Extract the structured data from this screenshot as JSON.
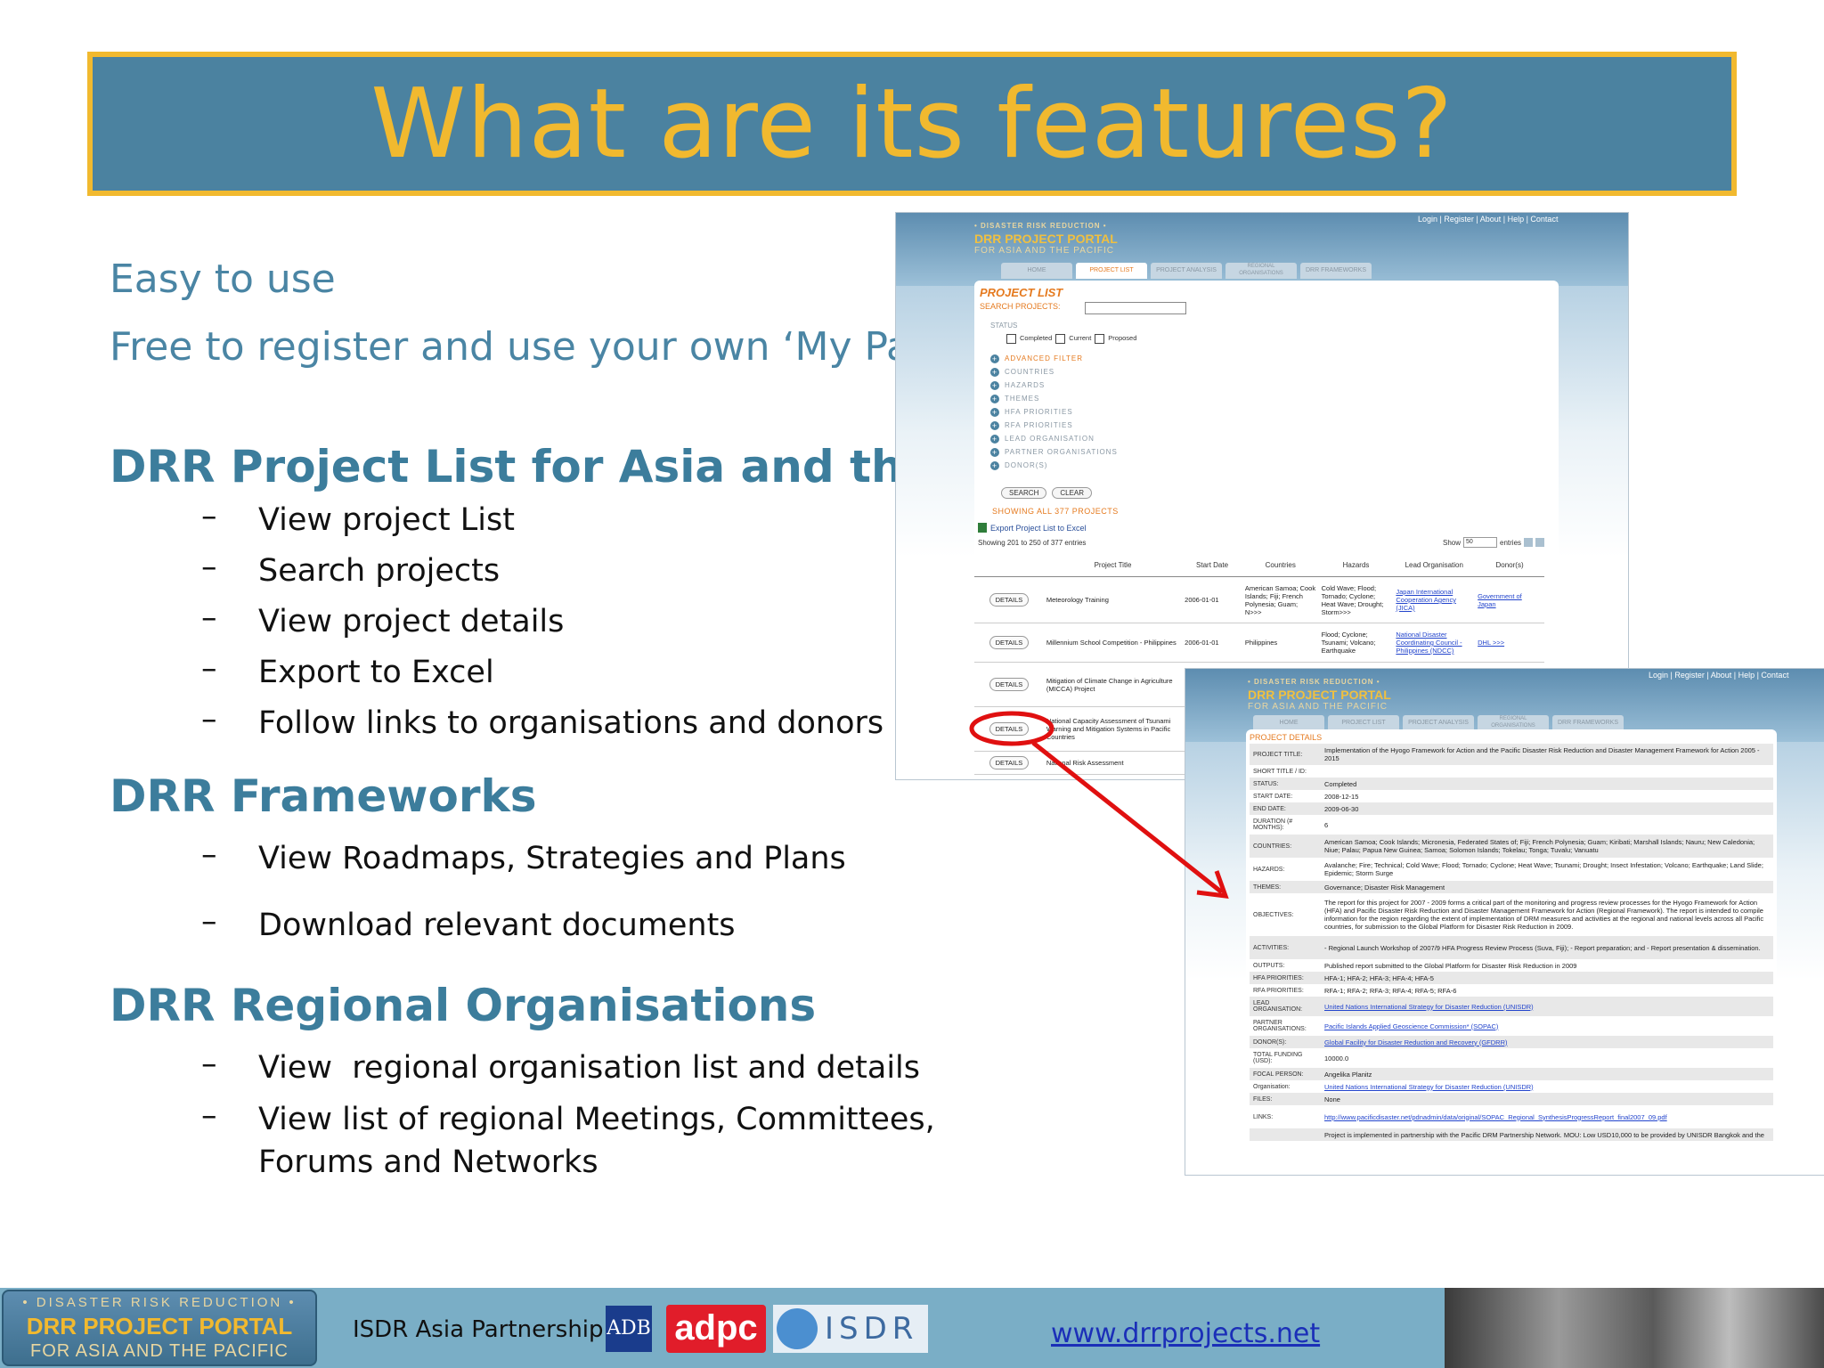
{
  "title": "What are its features?",
  "intro": [
    "Easy to use",
    "Free to register and use your own ‘My Page’"
  ],
  "sections": [
    {
      "heading": "DRR Project List for Asia and the Pacific",
      "bullets": [
        "View project List",
        "Search projects",
        "View project details",
        "Export to Excel",
        "Follow links to organisations and donors"
      ]
    },
    {
      "heading": "DRR Frameworks",
      "bullets": [
        "View Roadmaps, Strategies and Plans",
        "Download relevant documents"
      ]
    },
    {
      "heading": "DRR Regional Organisations",
      "bullets": [
        "View  regional organisation list and details",
        "View list of regional Meetings, Committees,\nForums and Networks"
      ]
    }
  ],
  "bullet_dash": "–",
  "portal": {
    "line1": "• DISASTER RISK REDUCTION •",
    "line2": "DRR PROJECT PORTAL",
    "line3": "FOR ASIA AND THE PACIFIC",
    "toplinks": "Login | Register | About | Help | Contact",
    "tabs": [
      "HOME",
      "PROJECT LIST",
      "PROJECT ANALYSIS",
      "REGIONAL ORGANISATIONS",
      "DRR FRAMEWORKS"
    ]
  },
  "project_list": {
    "heading": "PROJECT LIST",
    "search_label": "SEARCH PROJECTS:",
    "status_label": "STATUS",
    "status_options": [
      "Completed",
      "Current",
      "Proposed"
    ],
    "filters": [
      "ADVANCED FILTER",
      "COUNTRIES",
      "HAZARDS",
      "THEMES",
      "HFA PRIORITIES",
      "RFA PRIORITIES",
      "LEAD ORGANISATION",
      "PARTNER ORGANISATIONS",
      "DONOR(S)"
    ],
    "search_btn": "SEARCH",
    "clear_btn": "CLEAR",
    "showing": "SHOWING ALL 377 PROJECTS",
    "export": "Export Project List to Excel",
    "showing_range": "Showing 201 to 250 of 377 entries",
    "show_label": "Show",
    "show_value": "50",
    "entries_label": "entries",
    "columns": [
      "",
      "Project Title",
      "Start Date",
      "Countries",
      "Hazards",
      "Lead Organisation",
      "Donor(s)"
    ],
    "details_btn": "DETAILS",
    "rows": [
      {
        "title": "Meteorology Training",
        "date": "2006-01-01",
        "countries": "American Samoa; Cook Islands; Fiji; French Polynesia; Guam; N>>>",
        "hazards": "Cold Wave; Flood; Tornado; Cyclone; Heat Wave; Drought; Storm>>>",
        "lead": "Japan International Cooperation Agency (JICA)",
        "donor": "Government of Japan"
      },
      {
        "title": "Millennium School Competition - Philippines",
        "date": "2006-01-01",
        "countries": "Philippines",
        "hazards": "Flood; Cyclone; Tsunami; Volcano; Earthquake",
        "lead": "National Disaster Coordinating Council - Philippines (NDCC)",
        "donor": "DHL >>>"
      },
      {
        "title": "Mitigation of Climate Change in Agriculture (MICCA) Project",
        "date": "",
        "countries": "",
        "hazards": "",
        "lead": "",
        "donor": ""
      },
      {
        "title": "National Capacity Assessment of Tsunami Warning and Mitigation Systems in Pacific Countries",
        "date": "",
        "countries": "",
        "hazards": "",
        "lead": "",
        "donor": ""
      },
      {
        "title": "National Risk Assessment",
        "date": "",
        "countries": "",
        "hazards": "",
        "lead": "",
        "donor": ""
      }
    ]
  },
  "project_details": {
    "heading": "PROJECT DETAILS",
    "fields": [
      {
        "label": "PROJECT TITLE:",
        "value": "Implementation of the Hyogo Framework for Action and the Pacific Disaster Risk Reduction and Disaster Management Framework for Action 2005 - 2015"
      },
      {
        "label": "SHORT TITLE / ID:",
        "value": ""
      },
      {
        "label": "STATUS:",
        "value": "Completed"
      },
      {
        "label": "START DATE:",
        "value": "2008-12-15"
      },
      {
        "label": "END DATE:",
        "value": "2009-06-30"
      },
      {
        "label": "DURATION (# MONTHS):",
        "value": "6"
      },
      {
        "label": "COUNTRIES:",
        "value": "American Samoa; Cook Islands; Micronesia, Federated States of; Fiji; French Polynesia; Guam; Kiribati; Marshall Islands; Nauru; New Caledonia; Niue; Palau; Papua New Guinea; Samoa; Solomon Islands; Tokelau; Tonga; Tuvalu; Vanuatu"
      },
      {
        "label": "HAZARDS:",
        "value": "Avalanche; Fire; Technical; Cold Wave; Flood; Tornado; Cyclone; Heat Wave; Tsunami; Drought; Insect Infestation; Volcano; Earthquake; Land Slide; Epidemic; Storm Surge"
      },
      {
        "label": "THEMES:",
        "value": "Governance; Disaster Risk Management"
      },
      {
        "label": "OBJECTIVES:",
        "value": "The report for this project for 2007 - 2009 forms a critical part of the monitoring and progress review processes for the Hyogo Framework for Action (HFA) and Pacific Disaster Risk Reduction and Disaster Management Framework for Action (Regional Framework). The report is intended to compile information for the region regarding the extent of implementation of DRM measures and activities at the regional and national levels across all Pacific countries, for submission to the Global Platform for Disaster Risk Reduction in 2009."
      },
      {
        "label": "ACTIVITIES:",
        "value": "- Regional Launch Workshop of 2007/9 HFA Progress Review Process (Suva, Fiji); - Report preparation; and - Report presentation & dissemination."
      },
      {
        "label": "OUTPUTS:",
        "value": "Published report submitted to the Global Platform for Disaster Risk Reduction in 2009"
      },
      {
        "label": "HFA PRIORITIES:",
        "value": "HFA-1; HFA-2; HFA-3; HFA-4; HFA-5"
      },
      {
        "label": "RFA PRIORITIES:",
        "value": "RFA-1; RFA-2; RFA-3; RFA-4; RFA-5; RFA-6"
      },
      {
        "label": "LEAD ORGANISATION:",
        "value": "United Nations International Strategy for Disaster Reduction (UNISDR)",
        "link": true
      },
      {
        "label": "PARTNER ORGANISATIONS:",
        "value": "Pacific Islands Applied Geoscience Commission* (SOPAC)",
        "link": true
      },
      {
        "label": "DONOR(S):",
        "value": "Global Facility for Disaster Reduction and Recovery (GFDRR)",
        "link": true
      },
      {
        "label": "TOTAL FUNDING (USD):",
        "value": "10000.0"
      },
      {
        "label": "FOCAL PERSON:",
        "value": "Angelika Planitz"
      },
      {
        "label": "Organisation:",
        "value": "United Nations International Strategy for Disaster Reduction (UNISDR)",
        "link": true
      },
      {
        "label": "FILES:",
        "value": "None"
      },
      {
        "label": "LINKS:",
        "value": "http://www.pacificdisaster.net/pdnadmin/data/original/SOPAC_Regional_SynthesisProgressReport_final2007_09.pdf",
        "link": true
      },
      {
        "label": "",
        "value": "Project is implemented in partnership with the Pacific DRM Partnership Network. MOU: Low USD10,000 to be provided by UNISDR Bangkok and the"
      }
    ]
  },
  "footer": {
    "logo_line1": "• DISASTER RISK REDUCTION •",
    "logo_line2": "DRR PROJECT PORTAL",
    "logo_line3": "FOR ASIA AND THE PACIFIC",
    "partnership": "ISDR Asia Partnership",
    "adb": "ADB",
    "adpc": "adpc",
    "isdr": "ISDR",
    "url": "www.drrprojects.net"
  },
  "colors": {
    "title_bg": "#4b82a0",
    "title_text": "#f1b92f",
    "accent_text": "#3c7d9c",
    "annotation": "#e01010",
    "footer_bg": "#7aaec6"
  }
}
